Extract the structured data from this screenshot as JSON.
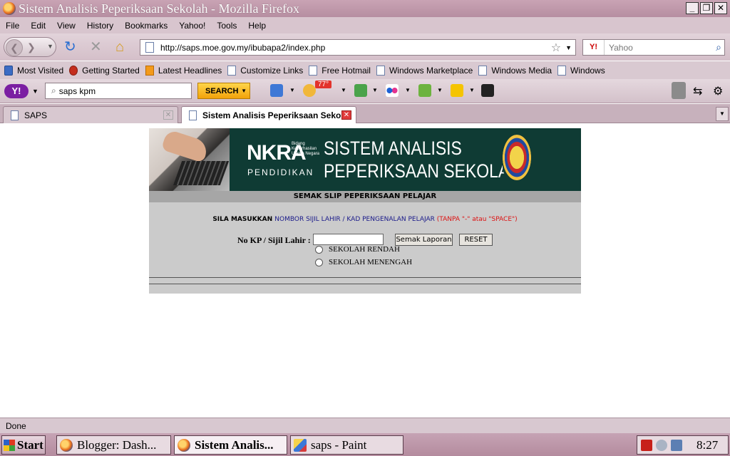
{
  "window": {
    "title": "Sistem Analisis Peperiksaan Sekolah - Mozilla Firefox",
    "minimize": "_",
    "restore": "❐",
    "close": "✕"
  },
  "menu": [
    "File",
    "Edit",
    "View",
    "History",
    "Bookmarks",
    "Yahoo!",
    "Tools",
    "Help"
  ],
  "nav": {
    "url": "http://saps.moe.gov.my/ibubapa2/index.php",
    "search_placeholder": "Yahoo",
    "search_engine": "Y!"
  },
  "bookmarks": [
    "Most Visited",
    "Getting Started",
    "Latest Headlines",
    "Customize Links",
    "Free Hotmail",
    "Windows Marketplace",
    "Windows Media",
    "Windows"
  ],
  "yahoo_toolbar": {
    "logo": "Y!",
    "query": "saps kpm",
    "search_button": "SEARCH",
    "weather_temp": "77°"
  },
  "tabs": [
    {
      "label": "SAPS",
      "active": false
    },
    {
      "label": "Sistem Analisis Peperiksaan Seko...",
      "active": true
    }
  ],
  "page": {
    "banner": {
      "nkra": "NKRA",
      "nkra_sub": "Bidang Keberhasilan Utama Negara",
      "pendidikan": "PENDIDIKAN",
      "line1": "SISTEM ANALISIS",
      "line2": "PEPERIKSAAN SEKOLAH"
    },
    "subheading": "SEMAK SLIP PEPERIKSAAN PELAJAR",
    "instruction": {
      "lead": "SILA MASUKKAN ",
      "blue": "NOMBOR SIJIL LAHIR / KAD PENGENALAN PELAJAR ",
      "red": "(TANPA \"-\" atau \"SPACE\")"
    },
    "form": {
      "label": "No KP / Sijil Lahir :",
      "input_value": "",
      "submit": "Semak Laporan",
      "reset": "RESET",
      "radios": [
        "SEKOLAH RENDAH",
        "SEKOLAH MENENGAH"
      ]
    }
  },
  "status": "Done",
  "taskbar": {
    "start": "Start",
    "tasks": [
      {
        "label": "Blogger: Dash...",
        "active": false
      },
      {
        "label": "Sistem Analis...",
        "active": true
      },
      {
        "label": "saps - Paint",
        "active": false
      }
    ],
    "clock": "8:27"
  }
}
